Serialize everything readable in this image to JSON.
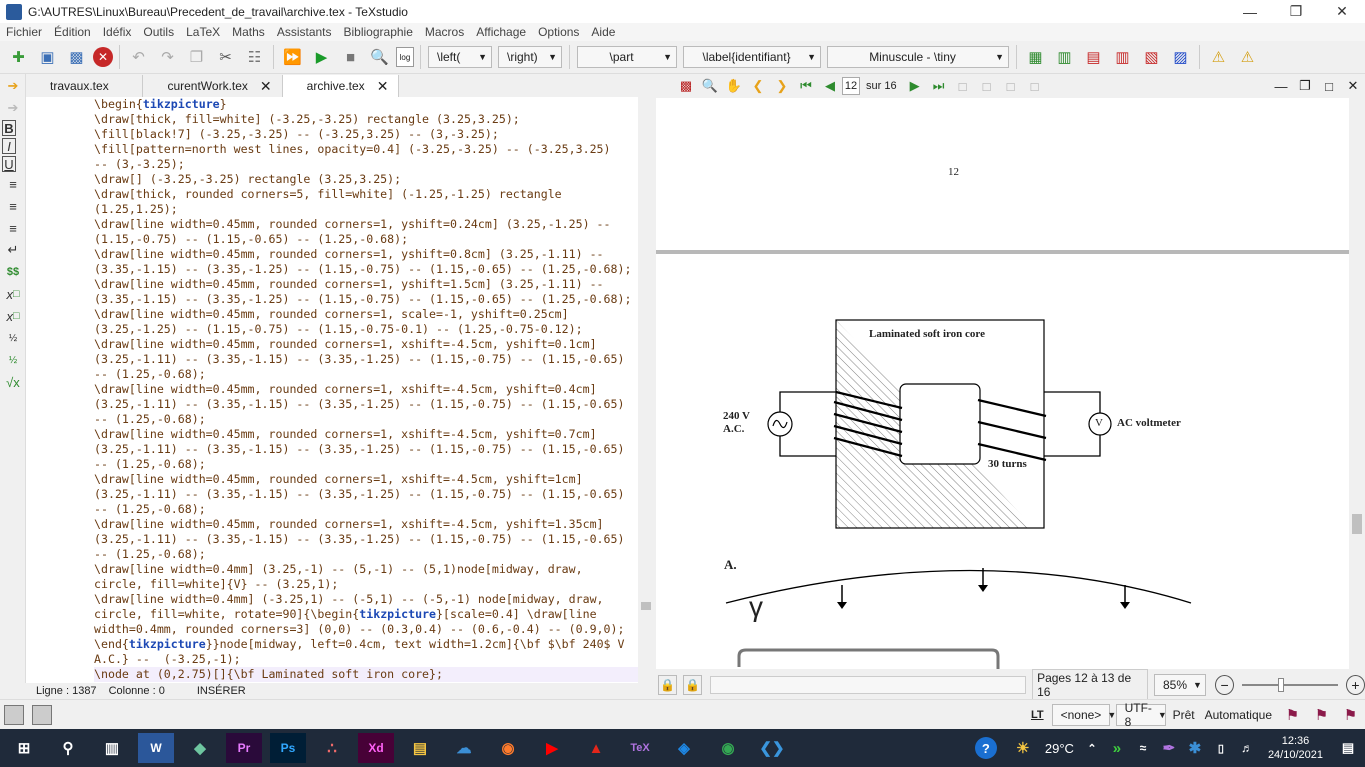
{
  "window": {
    "title": "G:\\AUTRES\\Linux\\Bureau\\Precedent_de_travail\\archive.tex - TeXstudio"
  },
  "menu": [
    "Fichier",
    "Édition",
    "Idéfix",
    "Outils",
    "LaTeX",
    "Maths",
    "Assistants",
    "Bibliographie",
    "Macros",
    "Affichage",
    "Options",
    "Aide"
  ],
  "toolbar": {
    "left_delim": "\\left(",
    "right_delim": "\\right)",
    "sectioning": "\\part",
    "label": "\\label{identifiant}",
    "size": "Minuscule - \\tiny",
    "log_label": "log"
  },
  "tabs": [
    {
      "label": "travaux.tex"
    },
    {
      "label": "curentWork.tex"
    },
    {
      "label": "archive.tex"
    }
  ],
  "editor": {
    "lines": [
      "\\begin{tikzpicture}",
      "\\draw[thick, fill=white] (-3.25,-3.25) rectangle (3.25,3.25);",
      "\\fill[black!7] (-3.25,-3.25) -- (-3.25,3.25) -- (3,-3.25);",
      "\\fill[pattern=north west lines, opacity=0.4] (-3.25,-3.25) -- (-3.25,3.25)",
      "-- (3,-3.25);",
      "\\draw[] (-3.25,-3.25) rectangle (3.25,3.25);",
      "\\draw[thick, rounded corners=5, fill=white] (-1.25,-1.25) rectangle",
      "(1.25,1.25);",
      "\\draw[line width=0.45mm, rounded corners=1, yshift=0.24cm] (3.25,-1.25) --",
      "(1.15,-0.75) -- (1.15,-0.65) -- (1.25,-0.68);",
      "\\draw[line width=0.45mm, rounded corners=1, yshift=0.8cm] (3.25,-1.11) --",
      "(3.35,-1.15) -- (3.35,-1.25) -- (1.15,-0.75) -- (1.15,-0.65) -- (1.25,-0.68);",
      "\\draw[line width=0.45mm, rounded corners=1, yshift=1.5cm] (3.25,-1.11) --",
      "(3.35,-1.15) -- (3.35,-1.25) -- (1.15,-0.75) -- (1.15,-0.65) -- (1.25,-0.68);",
      "\\draw[line width=0.45mm, rounded corners=1, scale=-1, yshift=0.25cm]",
      "(3.25,-1.25) -- (1.15,-0.75) -- (1.15,-0.75-0.1) -- (1.25,-0.75-0.12);",
      "\\draw[line width=0.45mm, rounded corners=1, xshift=-4.5cm, yshift=0.1cm]",
      "(3.25,-1.11) -- (3.35,-1.15) -- (3.35,-1.25) -- (1.15,-0.75) -- (1.15,-0.65)",
      "-- (1.25,-0.68);",
      "\\draw[line width=0.45mm, rounded corners=1, xshift=-4.5cm, yshift=0.4cm]",
      "(3.25,-1.11) -- (3.35,-1.15) -- (3.35,-1.25) -- (1.15,-0.75) -- (1.15,-0.65)",
      "-- (1.25,-0.68);",
      "\\draw[line width=0.45mm, rounded corners=1, xshift=-4.5cm, yshift=0.7cm]",
      "(3.25,-1.11) -- (3.35,-1.15) -- (3.35,-1.25) -- (1.15,-0.75) -- (1.15,-0.65)",
      "-- (1.25,-0.68);",
      "\\draw[line width=0.45mm, rounded corners=1, xshift=-4.5cm, yshift=1cm]",
      "(3.25,-1.11) -- (3.35,-1.15) -- (3.35,-1.25) -- (1.15,-0.75) -- (1.15,-0.65)",
      "-- (1.25,-0.68);",
      "\\draw[line width=0.45mm, rounded corners=1, xshift=-4.5cm, yshift=1.35cm]",
      "(3.25,-1.11) -- (3.35,-1.15) -- (3.35,-1.25) -- (1.15,-0.75) -- (1.15,-0.65)",
      "-- (1.25,-0.68);",
      "\\draw[line width=0.4mm] (3.25,-1) -- (5,-1) -- (5,1)node[midway, draw,",
      "circle, fill=white]{V} -- (3.25,1);",
      "\\draw[line width=0.4mm] (-3.25,1) -- (-5,1) -- (-5,-1) node[midway, draw,",
      "circle, fill=white, rotate=90]{\\begin{tikzpicture}[scale=0.4] \\draw[line",
      "width=0.4mm, rounded corners=3] (0,0) -- (0.3,0.4) -- (0.6,-0.4) -- (0.9,0);",
      "\\end{tikzpicture}}node[midway, left=0.4cm, text width=1.2cm]{\\bf $\\bf 240$ V",
      "A.C.} --  (-3.25,-1);",
      "\\node at (0,2.75)[]{\\bf Laminated soft iron core};"
    ]
  },
  "status": {
    "line": "Ligne : 1387",
    "column": "Colonne : 0",
    "mode": "INSÉRER"
  },
  "pdf": {
    "page_input": "12",
    "page_of": "sur 16",
    "page_number": "12",
    "core_label": "Laminated soft iron core",
    "voltage_label": "240 V",
    "ac_label": "A.C.",
    "voltmeter_label": "AC voltmeter",
    "voltmeter_symbol": "V",
    "turns_label": "30 turns",
    "option_label": "A.",
    "gamma_label": "γ",
    "pages_range": "Pages 12 à 13 de 16",
    "zoom": "85%"
  },
  "bottom": {
    "lt": "LT",
    "none": "<none>",
    "encoding": "UTF-8",
    "ready": "Prêt",
    "auto": "Automatique"
  },
  "taskbar": {
    "temperature": "29°C",
    "time": "12:36",
    "date": "24/10/2021"
  }
}
